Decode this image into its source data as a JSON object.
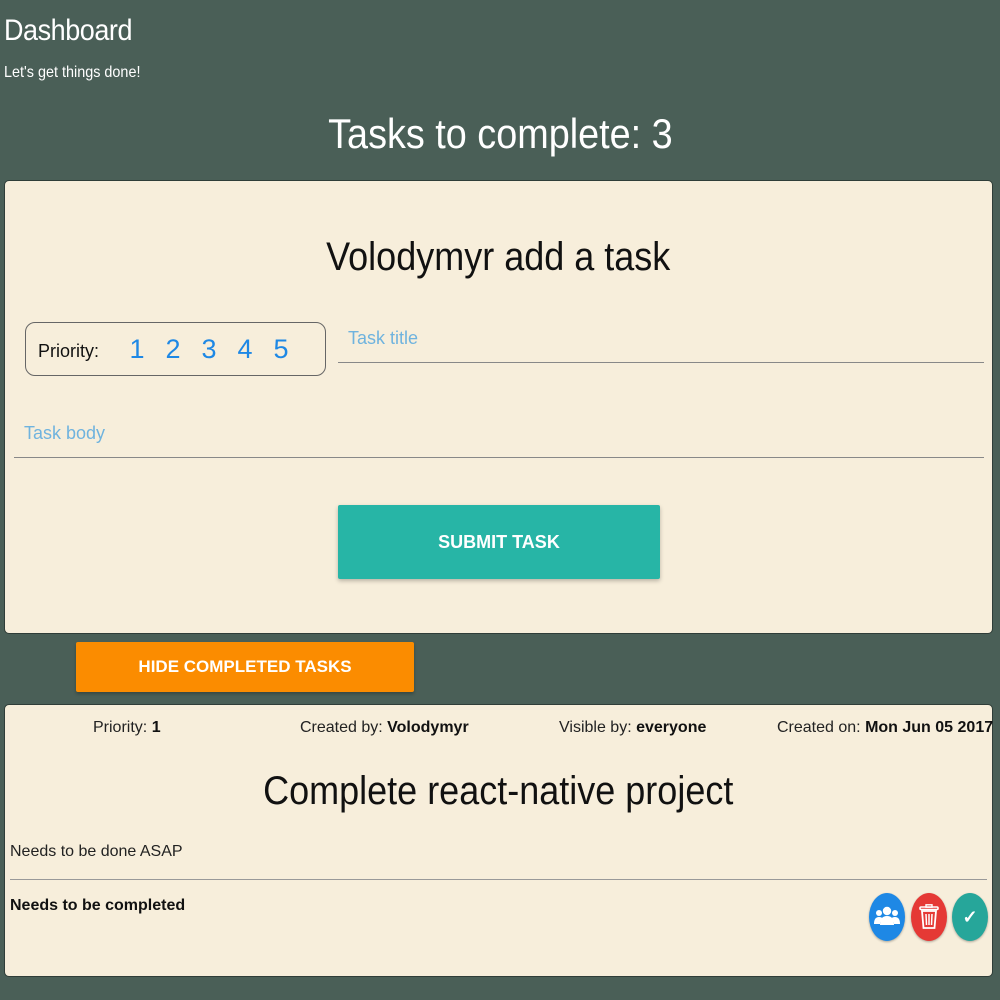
{
  "header": {
    "title": "Dashboard",
    "subtitle": "Let's get things done!",
    "tasks_label": "Tasks to complete: 3"
  },
  "form": {
    "heading": "Volodymyr add a task",
    "priority_label": "Priority:",
    "priority_options": [
      "1",
      "2",
      "3",
      "4",
      "5"
    ],
    "title_placeholder": "Task title",
    "body_placeholder": "Task body",
    "submit_label": "SUBMIT TASK"
  },
  "hide_completed_label": "HIDE COMPLETED TASKS",
  "task": {
    "priority_label": "Priority:",
    "priority_value": "1",
    "created_by_label": "Created by:",
    "created_by_value": "Volodymyr",
    "visible_by_label": "Visible by:",
    "visible_by_value": "everyone",
    "created_on_label": "Created on:",
    "created_on_value": "Mon Jun 05 2017",
    "title": "Complete react-native project",
    "body": "Needs to be done ASAP",
    "status": "Needs to be completed",
    "actions": [
      "group-icon",
      "trash-icon",
      "check-icon"
    ]
  },
  "colors": {
    "background": "#4a5f57",
    "card": "#f7eedb",
    "accent_teal": "#27b5a6",
    "accent_orange": "#fb8c00",
    "priority_blue": "#1e88e5",
    "delete_red": "#e53935"
  }
}
